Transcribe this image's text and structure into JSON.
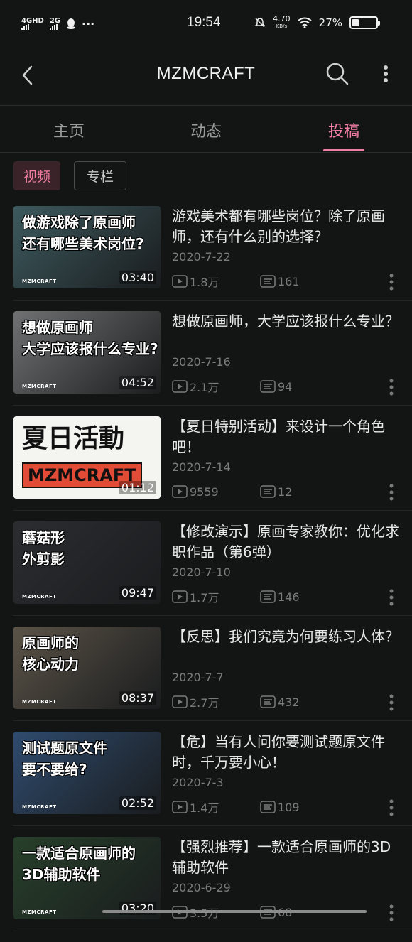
{
  "status_bar": {
    "net1": "4GHD",
    "net2": "2G",
    "dots": "···",
    "time": "19:54",
    "speed_value": "4.70",
    "speed_unit": "KB/s",
    "battery": "27%",
    "battery_level": 0.27
  },
  "header": {
    "title": "MZMCRAFT"
  },
  "tabs": [
    {
      "label": "主页"
    },
    {
      "label": "动态"
    },
    {
      "label": "投稿"
    }
  ],
  "filters": [
    {
      "label": "视频"
    },
    {
      "label": "专栏"
    }
  ],
  "videos": [
    {
      "thumb_text_1": "做游戏除了原画师",
      "thumb_text_2": "还有哪些美术岗位?",
      "thumb_logo": "MZMCRAFT",
      "duration": "03:40",
      "title": "游戏美术都有哪些岗位？除了原画师，还有什么别的选择？",
      "date": "2020-7-22",
      "views": "1.8万",
      "comments": "161",
      "bg": "#3d5a5e"
    },
    {
      "thumb_text_1": "想做原画师",
      "thumb_text_2": "大学应该报什么专业?",
      "thumb_logo": "MZMCRAFT",
      "duration": "04:52",
      "title": "想做原画师，大学应该报什么专业？",
      "date": "2020-7-16",
      "views": "2.1万",
      "comments": "94",
      "bg": "#6f7173"
    },
    {
      "thumb_text_1": "夏日活動",
      "thumb_text_2": "MZMCRAFT",
      "thumb_logo": "",
      "duration": "01:12",
      "title": "【夏日特别活动】来设计一个角色吧！",
      "date": "2020-7-14",
      "views": "9559",
      "comments": "12",
      "bg": "#f4f4f0"
    },
    {
      "thumb_text_1": "蘑菇形",
      "thumb_text_2": "外剪影",
      "thumb_logo": "MZMCRAFT",
      "duration": "09:47",
      "title": "【修改演示】原画专家教你：优化求职作品（第6弹）",
      "date": "2020-7-10",
      "views": "1.7万",
      "comments": "146",
      "bg": "#2c2d31"
    },
    {
      "thumb_text_1": "原画师的",
      "thumb_text_2": "核心动力",
      "thumb_logo": "MZMCRAFT",
      "duration": "08:37",
      "title": "【反思】我们究竟为何要练习人体？",
      "date": "2020-7-7",
      "views": "2.7万",
      "comments": "432",
      "bg": "#5b5347"
    },
    {
      "thumb_text_1": "测试题原文件",
      "thumb_text_2": "要不要给?",
      "thumb_logo": "MZMCRAFT",
      "duration": "02:52",
      "title": "【危】当有人问你要测试题原文件时，千万要小心！",
      "date": "2020-7-3",
      "views": "1.4万",
      "comments": "109",
      "bg": "#2f4b6e"
    },
    {
      "thumb_text_1": "一款适合原画师的",
      "thumb_text_2": "3D辅助软件",
      "thumb_logo": "MZMCRAFT",
      "duration": "03:20",
      "title": "【强烈推荐】一款适合原画师的3D辅助软件",
      "date": "2020-6-29",
      "views": "3.5万",
      "comments": "68",
      "bg": "#27402a"
    }
  ]
}
